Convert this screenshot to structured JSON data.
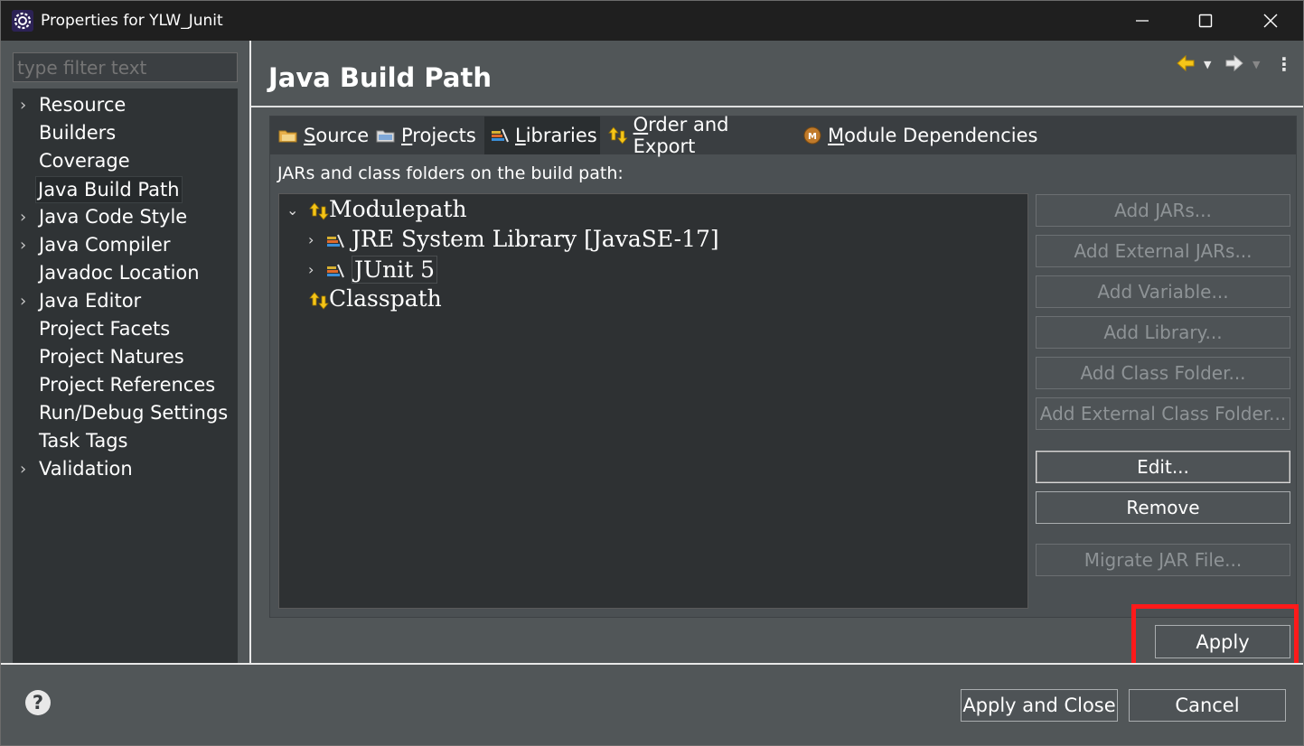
{
  "window": {
    "title": "Properties for YLW_Junit",
    "controls": {
      "minimize": "—",
      "maximize": "☐",
      "close": "✕"
    }
  },
  "filter": {
    "placeholder": "type filter text"
  },
  "sidebar": {
    "items": [
      {
        "label": "Resource",
        "expandable": true
      },
      {
        "label": "Builders",
        "expandable": false
      },
      {
        "label": "Coverage",
        "expandable": false
      },
      {
        "label": "Java Build Path",
        "expandable": false,
        "selected": true
      },
      {
        "label": "Java Code Style",
        "expandable": true
      },
      {
        "label": "Java Compiler",
        "expandable": true
      },
      {
        "label": "Javadoc Location",
        "expandable": false
      },
      {
        "label": "Java Editor",
        "expandable": true
      },
      {
        "label": "Project Facets",
        "expandable": false
      },
      {
        "label": "Project Natures",
        "expandable": false
      },
      {
        "label": "Project References",
        "expandable": false
      },
      {
        "label": "Run/Debug Settings",
        "expandable": false
      },
      {
        "label": "Task Tags",
        "expandable": false
      },
      {
        "label": "Validation",
        "expandable": true
      }
    ]
  },
  "page": {
    "title": "Java Build Path"
  },
  "tabs": [
    {
      "label": "Source",
      "mnemonic_index": 0,
      "active": false
    },
    {
      "label": "Projects",
      "mnemonic_index": 0,
      "active": false
    },
    {
      "label": "Libraries",
      "mnemonic_index": 0,
      "active": true
    },
    {
      "label": "Order and Export",
      "mnemonic_index": 0,
      "active": false
    },
    {
      "label": "Module Dependencies",
      "mnemonic_index": 0,
      "active": false
    }
  ],
  "libraries": {
    "heading": "JARs and class folders on the build path:",
    "tree": [
      {
        "label": "Modulepath",
        "level": 0,
        "expanded": true
      },
      {
        "label": "JRE System Library [JavaSE-17]",
        "level": 1,
        "expanded": false
      },
      {
        "label": "JUnit 5",
        "level": 1,
        "expanded": false
      },
      {
        "label": "Classpath",
        "level": 0,
        "expanded": false
      }
    ],
    "buttons": {
      "add_jars": "Add JARs...",
      "add_external_jars": "Add External JARs...",
      "add_variable": "Add Variable...",
      "add_library": "Add Library...",
      "add_class_folder": "Add Class Folder...",
      "add_external_class_folder": "Add External Class Folder...",
      "edit": "Edit...",
      "remove": "Remove",
      "migrate_jar": "Migrate JAR File..."
    }
  },
  "footer": {
    "apply": "Apply",
    "apply_and_close": "Apply and Close",
    "cancel": "Cancel",
    "help": "?"
  },
  "colors": {
    "highlight": "#ff1a1a",
    "panel_bg": "#515658",
    "tree_bg": "#2e3133"
  }
}
